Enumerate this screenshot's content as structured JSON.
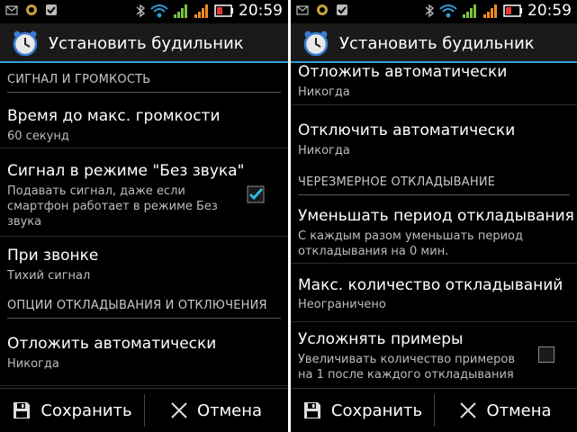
{
  "status": {
    "time": "20:59"
  },
  "app": {
    "title": "Установить будильник"
  },
  "left": {
    "cat1": "СИГНАЛ И ГРОМКОСТЬ",
    "items": [
      {
        "title": "Время до макс. громкости",
        "summary": "60 секунд"
      },
      {
        "title": "Сигнал в режиме \"Без звука\"",
        "summary": "Подавать сигнал, даже если смартфон работает в режиме Без звука",
        "checked": true
      },
      {
        "title": "При звонке",
        "summary": "Тихий сигнал"
      }
    ],
    "cat2": "ОПЦИИ ОТКЛАДЫВАНИЯ И ОТКЛЮЧЕНИЯ",
    "items2": [
      {
        "title": "Отложить автоматически",
        "summary": "Никогда"
      }
    ]
  },
  "right": {
    "items": [
      {
        "title": "Отложить автоматически",
        "summary": "Никогда"
      },
      {
        "title": "Отключить автоматически",
        "summary": "Никогда"
      }
    ],
    "cat": "ЧЕРЕЗМЕРНОЕ ОТКЛАДЫВАНИЕ",
    "items2": [
      {
        "title": "Уменьшать период откладывания",
        "summary": "С каждым разом уменьшать период откладывания на 0 мин."
      },
      {
        "title": "Макс. количество откладываний",
        "summary": "Неограничено"
      },
      {
        "title": "Усложнять примеры",
        "summary": "Увеличивать количество примеров на 1 после каждого откладывания",
        "checked": false
      }
    ]
  },
  "buttons": {
    "save": "Сохранить",
    "cancel": "Отмена"
  },
  "colors": {
    "accent": "#2f9fd8",
    "check": "#33b5e5"
  }
}
